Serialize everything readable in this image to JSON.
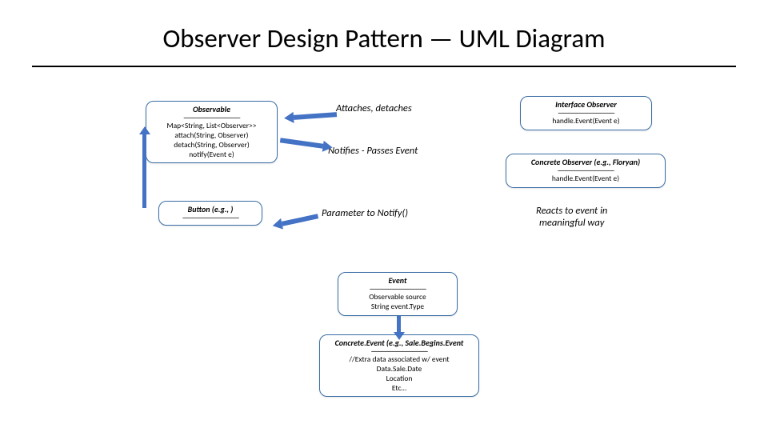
{
  "title": "Observer Design Pattern — UML Diagram",
  "observable": {
    "head": "Observable",
    "sep": "----------------------------------------",
    "body": "Map<String, List<Observer>>\nattach(String, Observer)\ndetach(String, Observer)\nnotify(Event e)"
  },
  "button": {
    "head": "Button (e.g., )",
    "sep": "----------------------------------------"
  },
  "iface": {
    "head": "Interface Observer",
    "sep": "----------------------------------------",
    "body": "handle.Event(Event e)"
  },
  "concrete_obs": {
    "head": "Concrete Observer (e.g., Floryan)",
    "sep": "----------------------------------------",
    "body": "handle.Event(Event e)"
  },
  "event": {
    "head": "Event",
    "sep": "----------------------------------------",
    "body": "Observable source\nString event.Type"
  },
  "concrete_event": {
    "head": "Concrete.Event (e.g., Sale.Begins.Event",
    "sep": "----------------------------------------",
    "body": "//Extra data associated w/ event\nData.Sale.Date\nLocation\nEtc…"
  },
  "ann": {
    "attach": "Attaches, detaches",
    "notify": "Notifies - Passes Event",
    "param": "Parameter to Notify()",
    "reacts": "Reacts to event in\nmeaningful way"
  }
}
